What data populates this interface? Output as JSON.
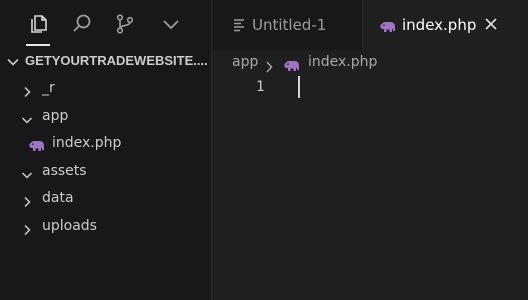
{
  "activity_bar": {
    "items": [
      "explorer",
      "search",
      "source-control",
      "more"
    ]
  },
  "explorer": {
    "section_title": "GETYOURTRADEWEBSITE....",
    "tree": [
      {
        "label": "_r",
        "type": "folder",
        "expanded": false
      },
      {
        "label": "app",
        "type": "folder",
        "expanded": true
      },
      {
        "label": "index.php",
        "type": "file"
      },
      {
        "label": "assets",
        "type": "folder",
        "expanded": true
      },
      {
        "label": "data",
        "type": "folder",
        "expanded": false
      },
      {
        "label": "uploads",
        "type": "folder",
        "expanded": false
      }
    ]
  },
  "tabs": [
    {
      "label": "Untitled-1",
      "active": false
    },
    {
      "label": "index.php",
      "active": true
    }
  ],
  "breadcrumb": {
    "folder": "app",
    "file": "index.php"
  },
  "editor": {
    "line_numbers": [
      "1"
    ]
  },
  "colors": {
    "php_icon": "#a074c4",
    "background": "#1f1f1f",
    "sidebar": "#181818"
  }
}
